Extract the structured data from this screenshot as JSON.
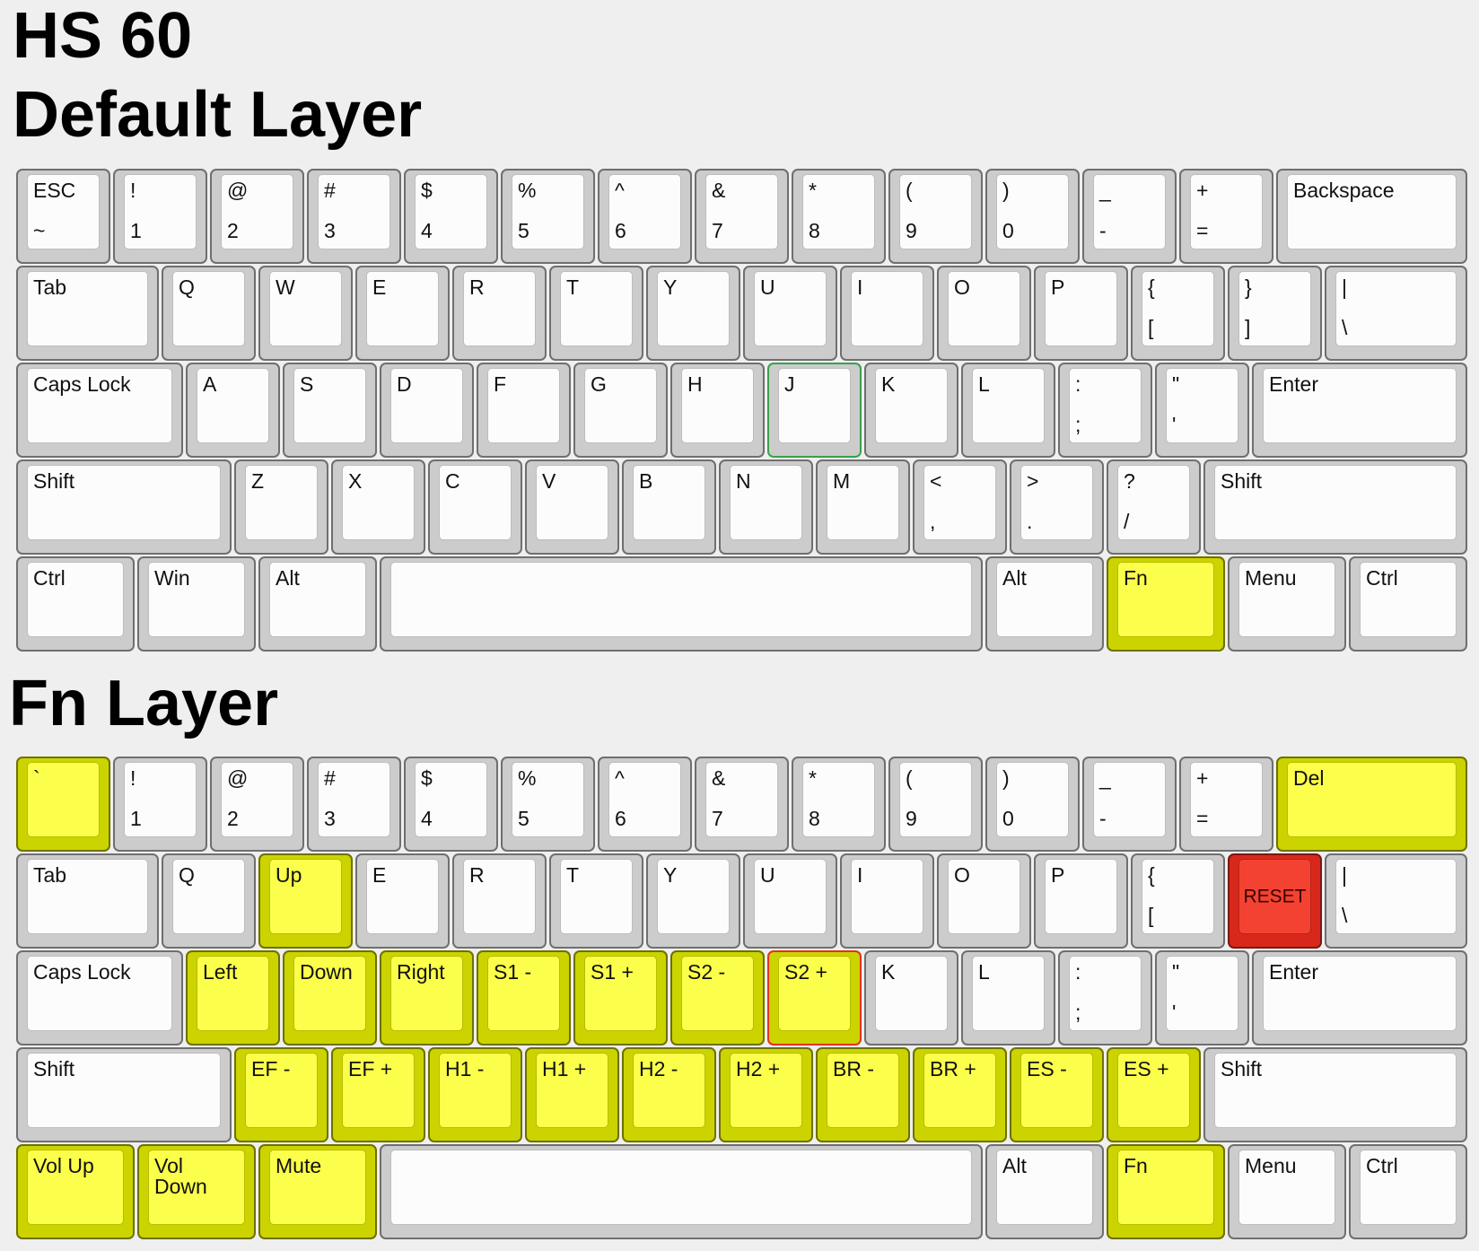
{
  "header": {
    "board_name": "HS 60",
    "default_layer_title": "Default Layer",
    "fn_layer_title": "Fn Layer"
  },
  "colors": {
    "background": "#efefef",
    "key_default": "#cccccc",
    "key_highlight_yellow": "#fbfe4a",
    "key_reset_red": "#f34231",
    "focus_green": "#37a24a",
    "focus_red": "#e4311f"
  },
  "layers": [
    {
      "id": "default",
      "rows": [
        [
          {
            "top": "ESC",
            "bot": "~"
          },
          {
            "top": "!",
            "bot": "1"
          },
          {
            "top": "@",
            "bot": "2"
          },
          {
            "top": "#",
            "bot": "3"
          },
          {
            "top": "$",
            "bot": "4"
          },
          {
            "top": "%",
            "bot": "5"
          },
          {
            "top": "^",
            "bot": "6"
          },
          {
            "top": "&",
            "bot": "7"
          },
          {
            "top": "*",
            "bot": "8"
          },
          {
            "top": "(",
            "bot": "9"
          },
          {
            "top": ")",
            "bot": "0"
          },
          {
            "top": "_",
            "bot": "-"
          },
          {
            "top": "+",
            "bot": "="
          },
          {
            "top": "Backspace",
            "w": 2
          }
        ],
        [
          {
            "top": "Tab",
            "w": 1.5
          },
          {
            "top": "Q"
          },
          {
            "top": "W"
          },
          {
            "top": "E"
          },
          {
            "top": "R"
          },
          {
            "top": "T"
          },
          {
            "top": "Y"
          },
          {
            "top": "U"
          },
          {
            "top": "I"
          },
          {
            "top": "O"
          },
          {
            "top": "P"
          },
          {
            "top": "{",
            "bot": "["
          },
          {
            "top": "}",
            "bot": "]"
          },
          {
            "top": "|",
            "bot": "\\",
            "w": 1.5
          }
        ],
        [
          {
            "top": "Caps Lock",
            "w": 1.75
          },
          {
            "top": "A"
          },
          {
            "top": "S"
          },
          {
            "top": "D"
          },
          {
            "top": "F"
          },
          {
            "top": "G"
          },
          {
            "top": "H"
          },
          {
            "top": "J",
            "hl": "green"
          },
          {
            "top": "K"
          },
          {
            "top": "L"
          },
          {
            "top": ":",
            "bot": ";"
          },
          {
            "top": "\"",
            "bot": "'"
          },
          {
            "top": "Enter",
            "w": 2.25
          }
        ],
        [
          {
            "top": "Shift",
            "w": 2.25
          },
          {
            "top": "Z"
          },
          {
            "top": "X"
          },
          {
            "top": "C"
          },
          {
            "top": "V"
          },
          {
            "top": "B"
          },
          {
            "top": "N"
          },
          {
            "top": "M"
          },
          {
            "top": "<",
            "bot": ","
          },
          {
            "top": ">",
            "bot": "."
          },
          {
            "top": "?",
            "bot": "/"
          },
          {
            "top": "Shift",
            "w": 2.75
          }
        ],
        [
          {
            "top": "Ctrl",
            "w": 1.25
          },
          {
            "top": "Win",
            "w": 1.25
          },
          {
            "top": "Alt",
            "w": 1.25
          },
          {
            "top": "",
            "w": 6.25
          },
          {
            "top": "Alt",
            "w": 1.25
          },
          {
            "top": "Fn",
            "w": 1.25,
            "color": "yellow"
          },
          {
            "top": "Menu",
            "w": 1.25
          },
          {
            "top": "Ctrl",
            "w": 1.25
          }
        ]
      ]
    },
    {
      "id": "fn",
      "rows": [
        [
          {
            "top": "`",
            "color": "yellow"
          },
          {
            "top": "!",
            "bot": "1"
          },
          {
            "top": "@",
            "bot": "2"
          },
          {
            "top": "#",
            "bot": "3"
          },
          {
            "top": "$",
            "bot": "4"
          },
          {
            "top": "%",
            "bot": "5"
          },
          {
            "top": "^",
            "bot": "6"
          },
          {
            "top": "&",
            "bot": "7"
          },
          {
            "top": "*",
            "bot": "8"
          },
          {
            "top": "(",
            "bot": "9"
          },
          {
            "top": ")",
            "bot": "0"
          },
          {
            "top": "_",
            "bot": "-"
          },
          {
            "top": "+",
            "bot": "="
          },
          {
            "top": "Del",
            "w": 2,
            "color": "yellow"
          }
        ],
        [
          {
            "top": "Tab",
            "w": 1.5
          },
          {
            "top": "Q"
          },
          {
            "top": "Up",
            "color": "yellow"
          },
          {
            "top": "E"
          },
          {
            "top": "R"
          },
          {
            "top": "T"
          },
          {
            "top": "Y"
          },
          {
            "top": "U"
          },
          {
            "top": "I"
          },
          {
            "top": "O"
          },
          {
            "top": "P"
          },
          {
            "top": "{",
            "bot": "["
          },
          {
            "center": "RESET",
            "color": "red"
          },
          {
            "top": "|",
            "bot": "\\",
            "w": 1.5
          }
        ],
        [
          {
            "top": "Caps Lock",
            "w": 1.75
          },
          {
            "top": "Left",
            "color": "yellow"
          },
          {
            "top": "Down",
            "color": "yellow"
          },
          {
            "top": "Right",
            "color": "yellow"
          },
          {
            "top": "S1 -",
            "color": "yellow"
          },
          {
            "top": "S1 +",
            "color": "yellow"
          },
          {
            "top": "S2 -",
            "color": "yellow"
          },
          {
            "top": "S2 +",
            "color": "yellow",
            "hl": "red"
          },
          {
            "top": "K"
          },
          {
            "top": "L"
          },
          {
            "top": ":",
            "bot": ";"
          },
          {
            "top": "\"",
            "bot": "'"
          },
          {
            "top": "Enter",
            "w": 2.25
          }
        ],
        [
          {
            "top": "Shift",
            "w": 2.25
          },
          {
            "top": "EF -",
            "color": "yellow"
          },
          {
            "top": "EF +",
            "color": "yellow"
          },
          {
            "top": "H1 -",
            "color": "yellow"
          },
          {
            "top": "H1 +",
            "color": "yellow"
          },
          {
            "top": "H2 -",
            "color": "yellow"
          },
          {
            "top": "H2 +",
            "color": "yellow"
          },
          {
            "top": "BR -",
            "color": "yellow"
          },
          {
            "top": "BR +",
            "color": "yellow"
          },
          {
            "top": "ES -",
            "color": "yellow"
          },
          {
            "top": "ES +",
            "color": "yellow"
          },
          {
            "top": "Shift",
            "w": 2.75
          }
        ],
        [
          {
            "top": "Vol Up",
            "w": 1.25,
            "color": "yellow"
          },
          {
            "top": "Vol\nDown",
            "w": 1.25,
            "color": "yellow"
          },
          {
            "top": "Mute",
            "w": 1.25,
            "color": "yellow"
          },
          {
            "top": "",
            "w": 6.25
          },
          {
            "top": "Alt",
            "w": 1.25
          },
          {
            "top": "Fn",
            "w": 1.25,
            "color": "yellow"
          },
          {
            "top": "Menu",
            "w": 1.25
          },
          {
            "top": "Ctrl",
            "w": 1.25
          }
        ]
      ]
    }
  ]
}
